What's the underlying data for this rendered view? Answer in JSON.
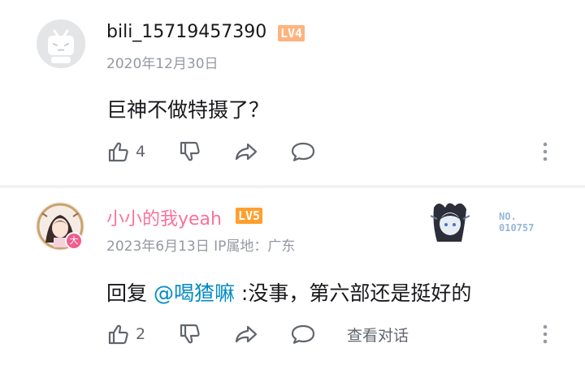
{
  "comments": [
    {
      "username": "bili_15719457390",
      "level": "LV4",
      "meta": "2020年12月30日",
      "text": "巨神不做特摄了？",
      "likes": "4",
      "avatar_icon": "bilibili-tv-default-avatar",
      "level_color": "#ffb37c"
    },
    {
      "username": "小小的我yeah",
      "level": "LV5",
      "meta": "2023年6月13日 IP属地：广东",
      "reply_prefix": "回复 ",
      "mention": "@喝猹嘛",
      "text": " :没事，第六部还是挺好的",
      "likes": "2",
      "view_replies": "查看对话",
      "decoration_label_1": "NO.",
      "decoration_label_2": "010757",
      "avatar_badge": "大",
      "name_color": "#fb7299",
      "level_color": "#ff9f2e"
    }
  ],
  "colors": {
    "text": "#18191c",
    "muted": "#9499a0",
    "icon": "#61666d",
    "mention": "#008ac5",
    "divider": "#f1f2f3"
  }
}
